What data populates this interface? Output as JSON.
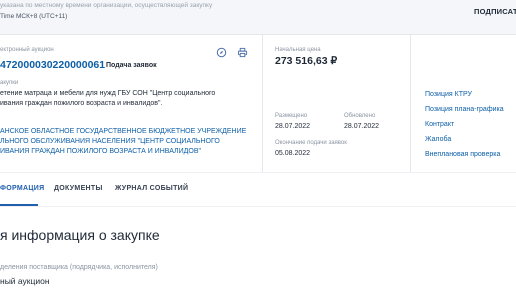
{
  "topbar": {
    "timezone_note": "указана по местному времени организации, осуществляющей закупку",
    "timezone_value": "Time МСК+8 (UTC+11)",
    "sign_button": "ПОДПИСАТЬ"
  },
  "procurement": {
    "type_label": "ектронный аукцион",
    "number": "472000030220000061",
    "submit_label": "Подача заявок",
    "object_label": "акупки",
    "object_lines": [
      "етение матраца и мебели для нужд ГБУ СОН \"Центр социального",
      "ивания граждан пожилого возраста и инвалидов\"."
    ],
    "org_lines": [
      "АНСКОЕ ОБЛАСТНОЕ ГОСУДАРСТВЕННОЕ БЮДЖЕТНОЕ УЧРЕЖДЕНИЕ",
      "ЛЬНОГО ОБСЛУЖИВАНИЯ НАСЕЛЕНИЯ \"ЦЕНТР СОЦИАЛЬНОГО",
      "ИВАНИЯ ГРАЖДАН ПОЖИЛОГО ВОЗРАСТА И ИНВАЛИДОВ\""
    ]
  },
  "pricing": {
    "price_label": "Начальная цена",
    "price_value": "273 516,63 ₽",
    "posted_label": "Размещено",
    "posted_value": "28.07.2022",
    "updated_label": "Обновлено",
    "updated_value": "28.07.2022",
    "deadline_label": "Окончание подачи заявок",
    "deadline_value": "05.08.2022"
  },
  "side_links": [
    "Позиция КТРУ",
    "Позиция плана-графика",
    "Контракт",
    "Жалоба",
    "Внеплановая проверка"
  ],
  "tabs": [
    "ФОРМАЦИЯ",
    "ДОКУМЕНТЫ",
    "ЖУРНАЛ СОБЫТИЙ"
  ],
  "section": {
    "title": "я информация о закупке",
    "field_label": "деления поставщика (подрядчика, исполнителя)",
    "field_value": "ный аукцион"
  },
  "colors": {
    "link": "#0d5fa8",
    "tab_active": "#1f5fae",
    "background": "#f4f6f9"
  },
  "icons": [
    "compass-icon",
    "printer-icon"
  ]
}
